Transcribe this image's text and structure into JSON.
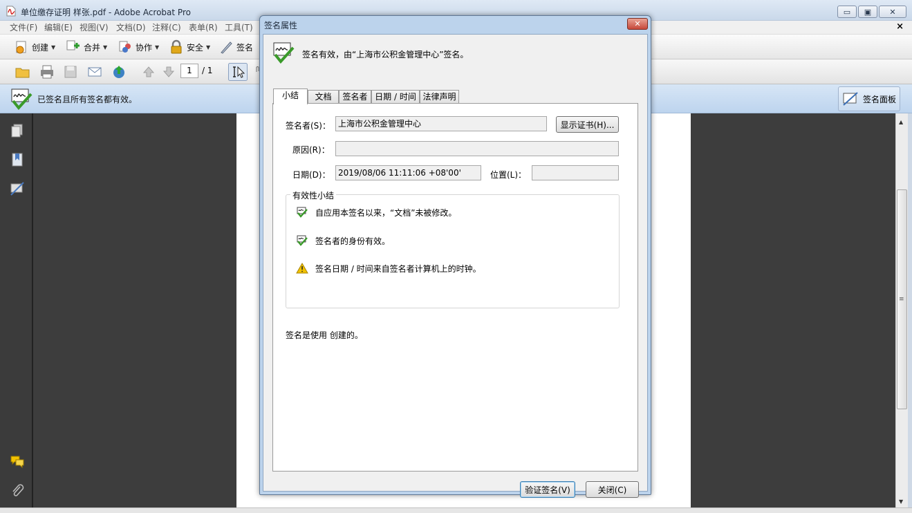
{
  "window": {
    "title": "单位缴存证明 样张.pdf - Adobe Acrobat Pro",
    "minimize_label": "▭",
    "maximize_label": "▣",
    "close_label": "✕"
  },
  "menu": {
    "items": [
      "文件(F)",
      "编辑(E)",
      "视图(V)",
      "文档(D)",
      "注释(C)",
      "表单(R)",
      "工具(T)"
    ],
    "doc_close": "×"
  },
  "toolbar": {
    "create": "创建",
    "combine": "合并",
    "collaborate": "协作",
    "secure": "安全",
    "sign": "签名"
  },
  "nav": {
    "page_current": "1",
    "page_total": "/ 1"
  },
  "signature_bar": {
    "message": "已签名且所有签名都有效。",
    "panel_button": "签名面板"
  },
  "dialog": {
    "title": "签名属性",
    "close_label": "✕",
    "header": "签名有效，由“上海市公积金管理中心”签名。",
    "tabs": [
      "小结",
      "文档",
      "签名者",
      "日期 / 时间",
      "法律声明"
    ],
    "signer_label": "签名者(S)：",
    "signer_value": "上海市公积金管理中心",
    "show_cert_button": "显示证书(H)...",
    "reason_label": "原因(R)：",
    "reason_value": "",
    "date_label": "日期(D)：",
    "date_value": "2019/08/06 11:11:06 +08'00'",
    "location_label": "位置(L)：",
    "location_value": "",
    "validity_group": "有效性小结",
    "validity_items": [
      "自应用本签名以来，“文档”未被修改。",
      "签名者的身份有效。",
      "签名日期 / 时间来自签名者计算机上的时钟。"
    ],
    "created_with": "签名是使用  创建的。",
    "validate_button": "验证签名(V)",
    "close_button": "关闭(C)"
  },
  "colors": {
    "valid_green": "#3a9a2a",
    "warning_yellow": "#f2c200",
    "sigbar_blue": "#c8dbf0",
    "doc_dark": "#3d3d3d"
  }
}
